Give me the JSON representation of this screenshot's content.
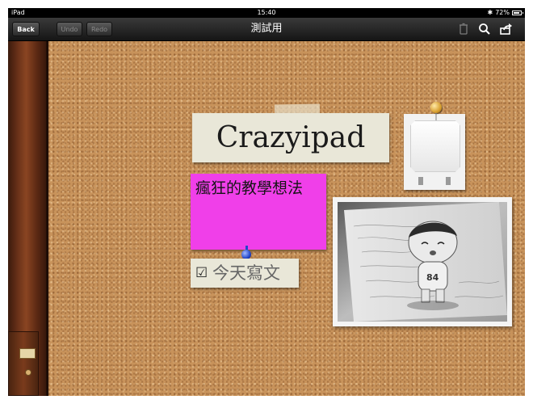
{
  "status_bar": {
    "carrier": "iPad",
    "time": "15:40",
    "battery": "72%"
  },
  "nav": {
    "back_label": "Back",
    "undo_label": "Undo",
    "redo_label": "Redo",
    "title": "測試用",
    "icons": [
      "trash-icon",
      "search-icon",
      "share-icon"
    ]
  },
  "board": {
    "title_note": "Crazyipad",
    "pink_note": "瘋狂的教學想法",
    "todo_note": "今天寫文",
    "todo_checked": true,
    "photo_figure_number": "84"
  },
  "colors": {
    "pink_note": "#f03fe9",
    "paper_note": "#e9e7d8",
    "cork": "#c8935b"
  }
}
